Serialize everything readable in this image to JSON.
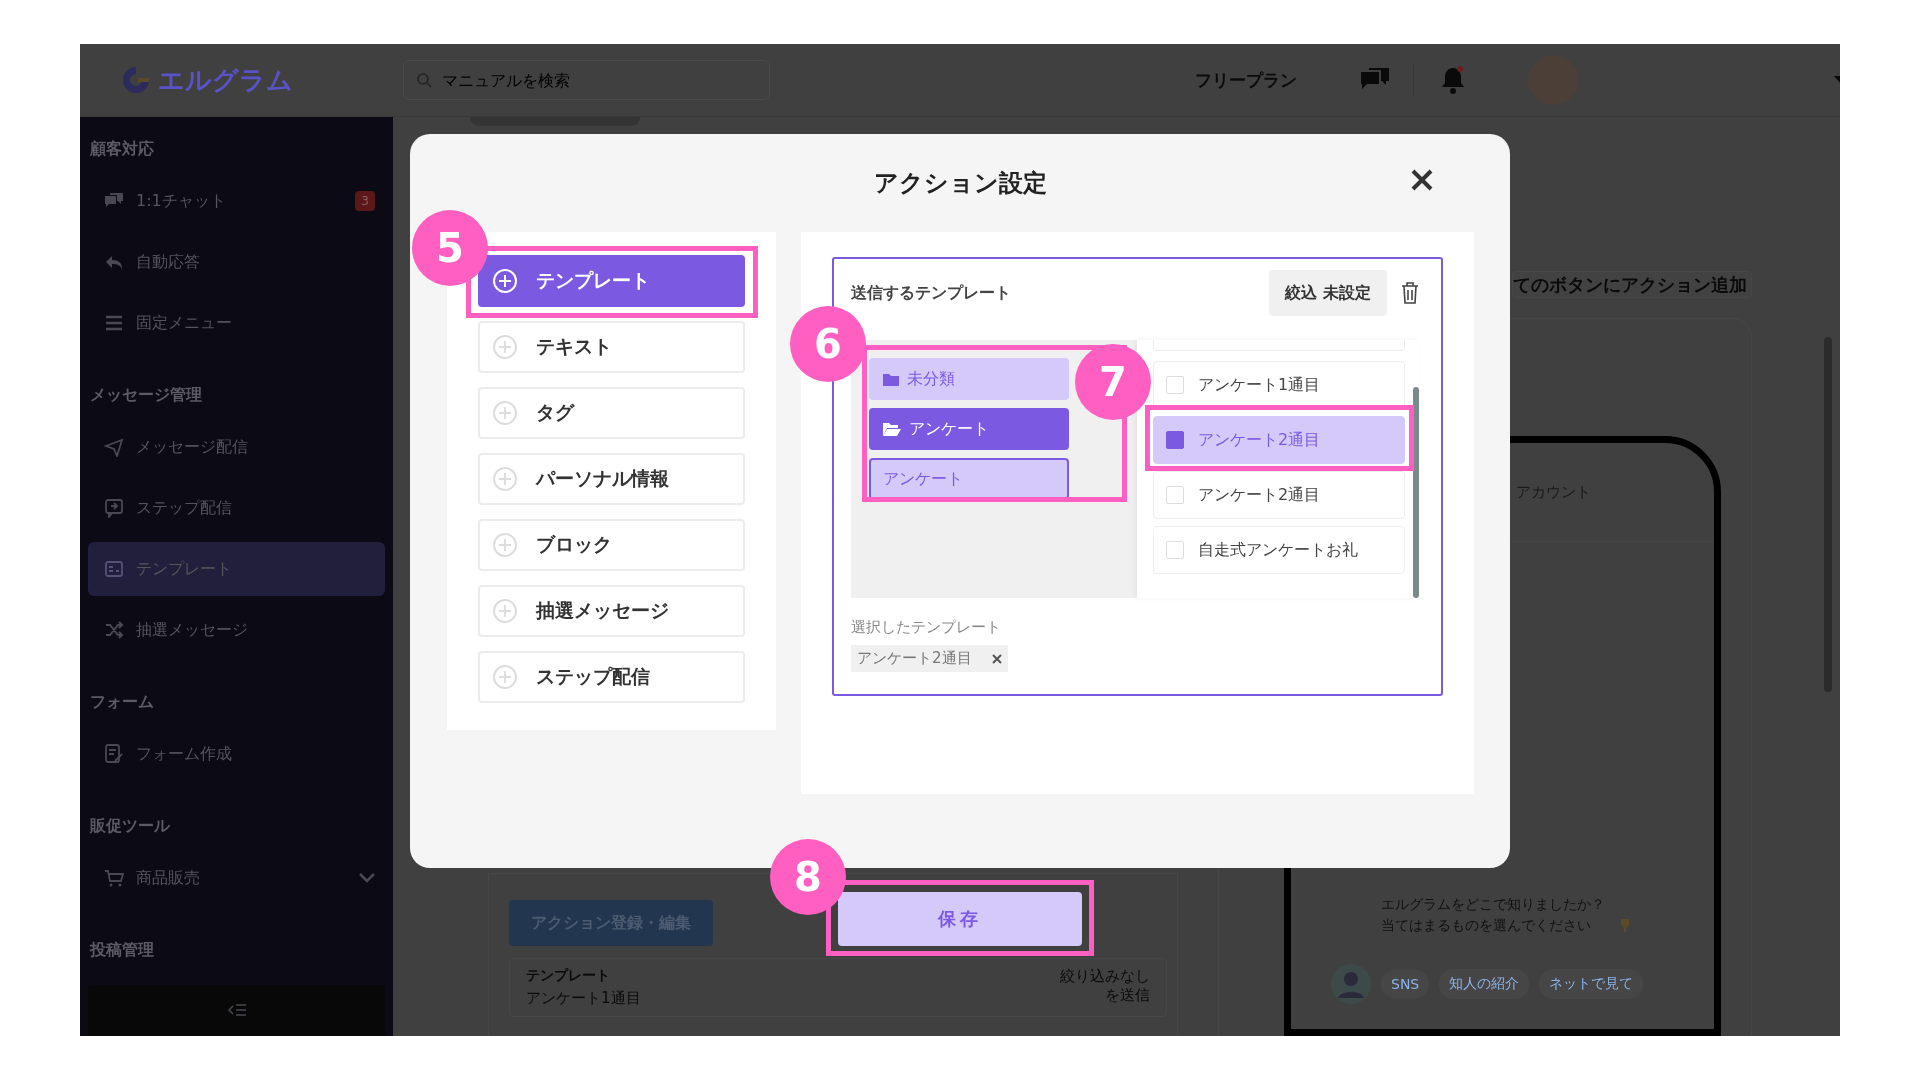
{
  "header": {
    "logo": "エルグラム",
    "search": {
      "placeholder": "マニュアルを検索"
    },
    "plan": "フリープラン"
  },
  "sidebar": {
    "sections": [
      {
        "title": "顧客対応",
        "items": [
          {
            "label": "1:1チャット",
            "kind": "link",
            "badge": "3",
            "selected": false
          },
          {
            "label": "自動応答",
            "kind": "link",
            "selected": false
          },
          {
            "label": "固定メニュー",
            "kind": "link",
            "selected": false
          }
        ]
      },
      {
        "title": "メッセージ管理",
        "items": [
          {
            "label": "メッセージ配信",
            "kind": "link",
            "selected": false
          },
          {
            "label": "ステップ配信",
            "kind": "link",
            "selected": false
          },
          {
            "label": "テンプレート",
            "kind": "link",
            "selected": true
          },
          {
            "label": "抽選メッセージ",
            "kind": "link",
            "selected": false
          }
        ]
      },
      {
        "title": "フォーム",
        "items": [
          {
            "label": "フォーム作成",
            "kind": "link",
            "selected": false
          }
        ]
      },
      {
        "title": "販促ツール",
        "items": [
          {
            "label": "商品販売",
            "kind": "group",
            "selected": false
          }
        ]
      },
      {
        "title": "投稿管理"
      }
    ]
  },
  "background": {
    "all_buttons_action": "てのボタンにアクション追加",
    "phone": {
      "account": "アカウント",
      "message": "エルグラムをどこで知りましたか？当てはまるものを選んでください",
      "choices": [
        "SNS",
        "知人の紹介",
        "ネットで見て"
      ]
    },
    "action_card": {
      "button": "アクション登録・編集",
      "type": "テンプレート",
      "name": "アンケート1通目",
      "note": "絞り込みなしを送信"
    }
  },
  "modal": {
    "title": "アクション設定",
    "actions": [
      {
        "label": "テンプレート",
        "selected": true
      },
      {
        "label": "テキスト",
        "selected": false
      },
      {
        "label": "タグ",
        "selected": false
      },
      {
        "label": "パーソナル情報",
        "selected": false
      },
      {
        "label": "ブロック",
        "selected": false
      },
      {
        "label": "抽選メッセージ",
        "selected": false
      },
      {
        "label": "ステップ配信",
        "selected": false
      }
    ],
    "template_picker": {
      "title": "送信するテンプレート",
      "filter_button": "絞込 未設定",
      "folders": [
        {
          "label": "未分類",
          "kind": "folder",
          "selected": false
        },
        {
          "label": "アンケート",
          "kind": "folder",
          "selected": true
        },
        {
          "label": "アンケート",
          "kind": "group",
          "selected": false
        }
      ],
      "templates": [
        {
          "label": "アンケート1通目",
          "checked": false
        },
        {
          "label": "アンケート2通目",
          "checked": true
        },
        {
          "label": "アンケート2通目",
          "checked": false
        },
        {
          "label": "自走式アンケートお礼",
          "checked": false
        }
      ],
      "selected_label": "選択したテンプレート",
      "selected_chips": [
        "アンケート2通目"
      ]
    },
    "save_button": "保存"
  },
  "annotations": [
    {
      "number": "5"
    },
    {
      "number": "6"
    },
    {
      "number": "7"
    },
    {
      "number": "8"
    }
  ]
}
